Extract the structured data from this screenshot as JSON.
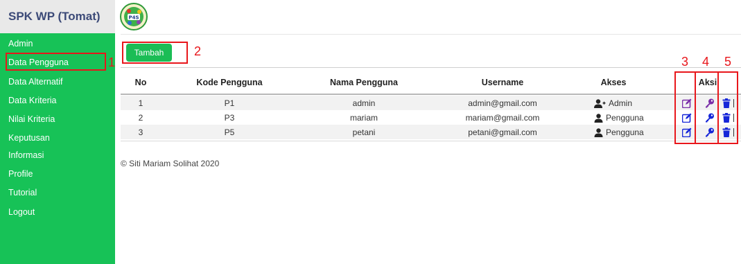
{
  "app": {
    "title": "SPK WP (Tomat)",
    "logo_text": "P4S"
  },
  "sidebar": {
    "items": [
      {
        "label": "Admin"
      },
      {
        "label": "Data Pengguna"
      },
      {
        "label": "Data Alternatif"
      },
      {
        "label": "Data Kriteria"
      },
      {
        "label": "Nilai Kriteria"
      },
      {
        "label": "Keputusan"
      },
      {
        "label": "Informasi"
      },
      {
        "label": "Profile"
      },
      {
        "label": "Tutorial"
      },
      {
        "label": "Logout"
      }
    ]
  },
  "main": {
    "add_button": "Tambah",
    "table": {
      "headers": [
        "No",
        "Kode Pengguna",
        "Nama Pengguna",
        "Username",
        "Akses",
        "Aksi"
      ],
      "rows": [
        {
          "no": "1",
          "kode": "P1",
          "nama": "admin",
          "username": "admin@gmail.com",
          "akses": "Admin",
          "akses_icon": "user-plus-icon"
        },
        {
          "no": "2",
          "kode": "P3",
          "nama": "mariam",
          "username": "mariam@gmail.com",
          "akses": "Pengguna",
          "akses_icon": "user-icon"
        },
        {
          "no": "3",
          "kode": "P5",
          "nama": "petani",
          "username": "petani@gmail.com",
          "akses": "Pengguna",
          "akses_icon": "user-icon"
        }
      ],
      "action_icons": [
        "edit-icon",
        "key-icon",
        "trash-icon"
      ]
    },
    "footer": "© Siti Mariam Solihat 2020"
  },
  "annotations": {
    "labels": [
      "1",
      "2",
      "3",
      "4",
      "5"
    ],
    "color": "#e8161b"
  },
  "colors": {
    "sidebar_bg": "#17c257",
    "brand_bg": "#e9e9e9",
    "brand_text": "#3c4a78",
    "button_bg": "#1bbd55",
    "row_stripe": "#f2f2f2",
    "icon_purple": "#7a2ea8",
    "icon_blue": "#1626d8"
  }
}
